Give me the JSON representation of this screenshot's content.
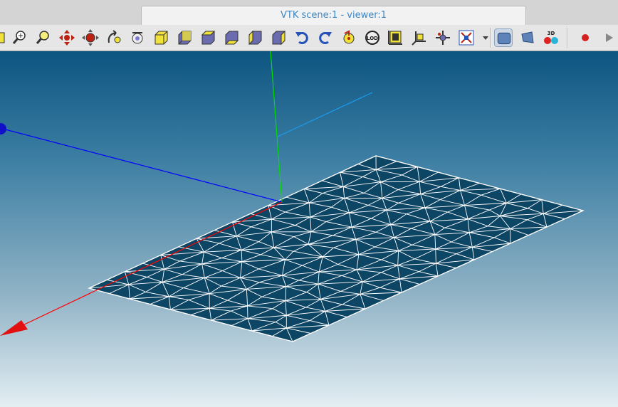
{
  "window": {
    "tab_title": "VTK scene:1 - viewer:1"
  },
  "toolbar": {
    "buttons": [
      {
        "name": "view-first-icon"
      },
      {
        "name": "zoom-icon"
      },
      {
        "name": "zoom-fit-icon"
      },
      {
        "name": "pan-icon"
      },
      {
        "name": "fit-all-icon"
      },
      {
        "name": "rotate-icon"
      },
      {
        "name": "rotation-point-icon"
      },
      {
        "name": "view-front-icon"
      },
      {
        "name": "view-back-icon"
      },
      {
        "name": "view-top-icon"
      },
      {
        "name": "view-bottom-icon"
      },
      {
        "name": "view-left-icon"
      },
      {
        "name": "view-right-icon"
      },
      {
        "name": "rotate-counterclockwise-icon"
      },
      {
        "name": "rotate-clockwise-icon"
      },
      {
        "name": "reset-view-icon"
      },
      {
        "name": "lod-icon"
      },
      {
        "name": "graduated-axes-icon"
      },
      {
        "name": "trihedron-icon"
      },
      {
        "name": "interaction-style-icon"
      },
      {
        "name": "clipping-plane-icon"
      },
      {
        "name": "dropdown-arrow-icon"
      },
      {
        "name": "parallel-projection-icon"
      },
      {
        "name": "perspective-projection-icon"
      },
      {
        "name": "stereo-3d-icon"
      },
      {
        "name": "record-icon"
      },
      {
        "name": "play-icon"
      }
    ],
    "lod_label": "LOD",
    "stereo_label": "3D"
  },
  "scene": {
    "background_top": "#0d5581",
    "background_bottom": "#e3eef3",
    "mesh_fill": "#0d4565",
    "mesh_edge": "#ffffff",
    "axis_x_color": "#ff0000",
    "axis_y_color": "#00e000",
    "axis_z_color": "#0000ff",
    "ray_color": "#1b9cf0",
    "mesh_rows": 10,
    "mesh_cols": 16
  }
}
